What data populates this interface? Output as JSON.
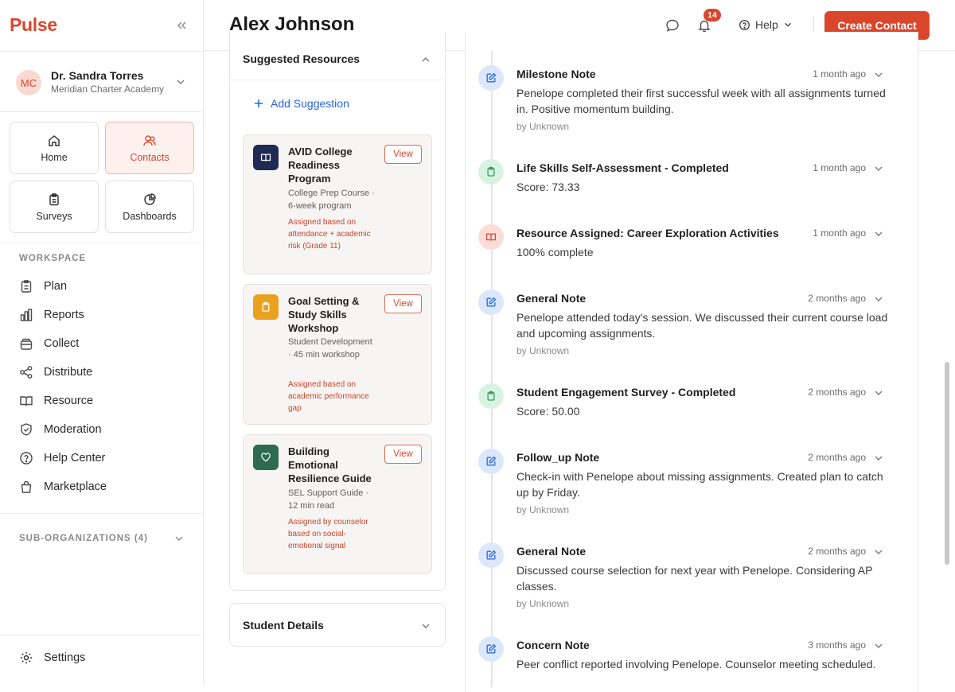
{
  "app": {
    "brand": "Pulse"
  },
  "org": {
    "initials": "MC",
    "name": "Dr. Sandra Torres",
    "subtitle": "Meridian Charter Academy"
  },
  "tiles": [
    {
      "label": "Home",
      "icon": "home-icon"
    },
    {
      "label": "Contacts",
      "icon": "contacts-icon",
      "active": true
    },
    {
      "label": "Surveys",
      "icon": "clipboard-icon"
    },
    {
      "label": "Dashboards",
      "icon": "pie-chart-icon"
    }
  ],
  "workspace": {
    "label": "WORKSPACE",
    "items": [
      {
        "label": "Plan",
        "icon": "clipboard-list-icon"
      },
      {
        "label": "Reports",
        "icon": "bar-chart-icon"
      },
      {
        "label": "Collect",
        "icon": "inbox-icon"
      },
      {
        "label": "Distribute",
        "icon": "share-icon"
      },
      {
        "label": "Resource",
        "icon": "book-icon"
      },
      {
        "label": "Moderation",
        "icon": "shield-check-icon"
      },
      {
        "label": "Help Center",
        "icon": "help-circle-icon"
      },
      {
        "label": "Marketplace",
        "icon": "shopping-bag-icon"
      }
    ]
  },
  "sub_orgs": {
    "label": "SUB-ORGANIZATIONS (4)"
  },
  "settings": {
    "label": "Settings"
  },
  "header": {
    "title": "Alex Johnson",
    "notifications_count": "14",
    "help_label": "Help",
    "create_label": "Create Contact"
  },
  "resources": {
    "heading": "Suggested Resources",
    "add_label": "Add Suggestion",
    "view_label": "View",
    "items": [
      {
        "title": "AVID College Readiness Program",
        "meta": "College Prep Course · 6-week program",
        "reason": "Assigned based on attendance + academic risk (Grade 11)",
        "icon": "book-open-icon",
        "color": "#1e2a52"
      },
      {
        "title": "Goal Setting & Study Skills Workshop",
        "meta": "Student Development · 45 min workshop",
        "reason": "Assigned based on academic performance gap",
        "icon": "clipboard-icon",
        "color": "#e9a21f"
      },
      {
        "title": "Building Emotional Resilience Guide",
        "meta": "SEL Support Guide · 12 min read",
        "reason": "Assigned by counselor based on social-emotional signal",
        "icon": "heart-icon",
        "color": "#2f6b4f"
      }
    ]
  },
  "details": {
    "heading": "Student Details"
  },
  "timeline": [
    {
      "title": "Milestone Note",
      "time": "1 month ago",
      "body": "Penelope completed their first successful week with all assignments turned in. Positive momentum building.",
      "by": "by Unknown",
      "kind": "blue",
      "icon": "edit-icon"
    },
    {
      "title": "Life Skills Self-Assessment - Completed",
      "time": "1 month ago",
      "body": "Score: 73.33",
      "by": "",
      "kind": "green",
      "icon": "clipboard-icon"
    },
    {
      "title": "Resource Assigned: Career Exploration Activities",
      "time": "1 month ago",
      "body": "100% complete",
      "by": "",
      "kind": "red",
      "icon": "book-open-icon"
    },
    {
      "title": "General Note",
      "time": "2 months ago",
      "body": "Penelope attended today's session. We discussed their current course load and upcoming assignments.",
      "by": "by Unknown",
      "kind": "blue",
      "icon": "edit-icon"
    },
    {
      "title": "Student Engagement Survey - Completed",
      "time": "2 months ago",
      "body": "Score: 50.00",
      "by": "",
      "kind": "green",
      "icon": "clipboard-icon"
    },
    {
      "title": "Follow_up Note",
      "time": "2 months ago",
      "body": "Check-in with Penelope about missing assignments. Created plan to catch up by Friday.",
      "by": "by Unknown",
      "kind": "blue",
      "icon": "edit-icon"
    },
    {
      "title": "General Note",
      "time": "2 months ago",
      "body": "Discussed course selection for next year with Penelope. Considering AP classes.",
      "by": "by Unknown",
      "kind": "blue",
      "icon": "edit-icon"
    },
    {
      "title": "Concern Note",
      "time": "3 months ago",
      "body": "Peer conflict reported involving Penelope. Counselor meeting scheduled.",
      "by": "",
      "kind": "blue",
      "icon": "edit-icon"
    }
  ],
  "colors": {
    "accent": "#d9462c",
    "link": "#2563eb"
  }
}
